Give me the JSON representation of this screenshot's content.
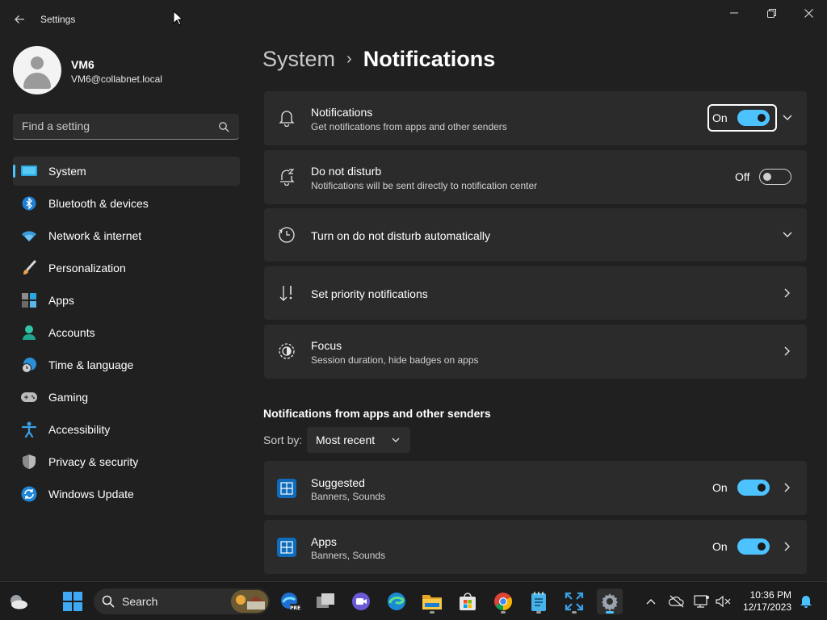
{
  "window": {
    "title": "Settings"
  },
  "user": {
    "name": "VM6",
    "email": "VM6@collabnet.local"
  },
  "search": {
    "placeholder": "Find a setting"
  },
  "sidebar": {
    "items": [
      {
        "label": "System",
        "icon": "system-display-icon",
        "active": true
      },
      {
        "label": "Bluetooth & devices",
        "icon": "bluetooth-icon"
      },
      {
        "label": "Network & internet",
        "icon": "wifi-icon"
      },
      {
        "label": "Personalization",
        "icon": "paintbrush-icon"
      },
      {
        "label": "Apps",
        "icon": "apps-icon"
      },
      {
        "label": "Accounts",
        "icon": "person-icon"
      },
      {
        "label": "Time & language",
        "icon": "globe-clock-icon"
      },
      {
        "label": "Gaming",
        "icon": "gamepad-icon"
      },
      {
        "label": "Accessibility",
        "icon": "accessibility-icon"
      },
      {
        "label": "Privacy & security",
        "icon": "shield-icon"
      },
      {
        "label": "Windows Update",
        "icon": "refresh-icon"
      }
    ]
  },
  "breadcrumb": {
    "parent": "System",
    "separator": "›",
    "current": "Notifications"
  },
  "settings": {
    "notifications": {
      "title": "Notifications",
      "subtitle": "Get notifications from apps and other senders",
      "state": "On"
    },
    "dnd": {
      "title": "Do not disturb",
      "subtitle": "Notifications will be sent directly to notification center",
      "state": "Off"
    },
    "dnd_auto": {
      "title": "Turn on do not disturb automatically"
    },
    "priority": {
      "title": "Set priority notifications"
    },
    "focus": {
      "title": "Focus",
      "subtitle": "Session duration, hide badges on apps"
    }
  },
  "senders": {
    "heading": "Notifications from apps and other senders",
    "sort_label": "Sort by:",
    "sort_value": "Most recent",
    "items": [
      {
        "title": "Suggested",
        "subtitle": "Banners, Sounds",
        "state": "On"
      },
      {
        "title": "Apps",
        "subtitle": "Banners, Sounds",
        "state": "On"
      }
    ]
  },
  "taskbar": {
    "search_label": "Search",
    "time": "10:36 PM",
    "date": "12/17/2023"
  },
  "colors": {
    "accent": "#4cc2ff",
    "background": "#202020",
    "card": "#2b2b2b"
  }
}
